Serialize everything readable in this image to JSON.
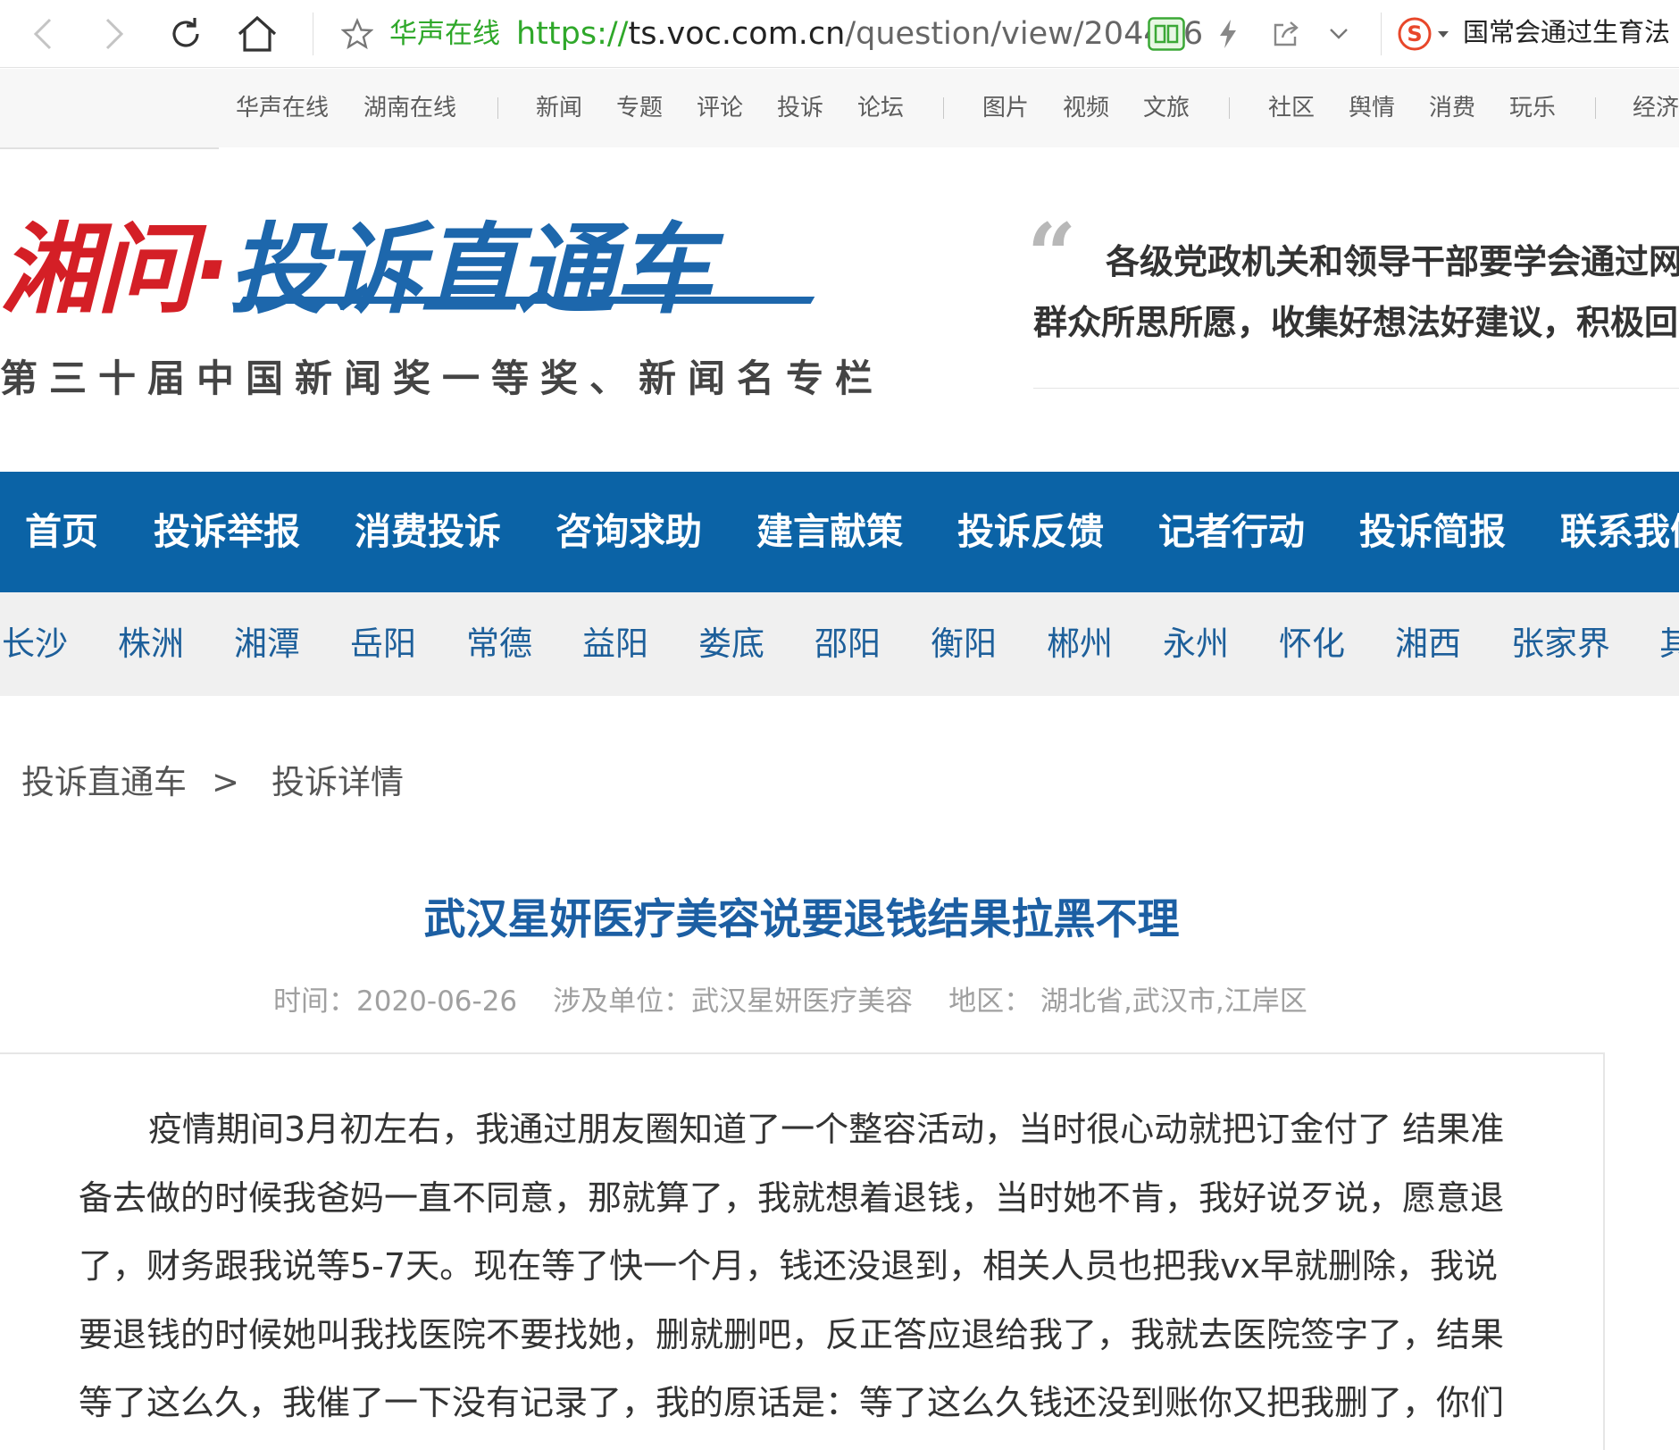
{
  "browser": {
    "site_name": "华声在线",
    "url_scheme": "https://",
    "url_host": "ts.voc.com.cn",
    "url_path": "/question/view/204486",
    "search_text": "国常会通过生育法"
  },
  "top_nav": {
    "items": [
      "华声在线",
      "湖南在线",
      "新闻",
      "专题",
      "评论",
      "投诉",
      "论坛",
      "图片",
      "视频",
      "文旅",
      "社区",
      "舆情",
      "消费",
      "玩乐",
      "经济"
    ]
  },
  "header": {
    "logo_red": "湘问·",
    "logo_blue": "投诉直通车",
    "logo_subtitle": "第三十届中国新闻奖一等奖、新闻名专栏",
    "quote_line1": "各级党政机关和领导干部要学会通过网",
    "quote_line2": "群众所思所愿，收集好想法好建议，积极回"
  },
  "main_nav": {
    "items": [
      "首页",
      "投诉举报",
      "消费投诉",
      "咨询求助",
      "建言献策",
      "投诉反馈",
      "记者行动",
      "投诉简报",
      "联系我们"
    ]
  },
  "region_nav": {
    "items": [
      "长沙",
      "株洲",
      "湘潭",
      "岳阳",
      "常德",
      "益阳",
      "娄底",
      "邵阳",
      "衡阳",
      "郴州",
      "永州",
      "怀化",
      "湘西",
      "张家界",
      "其他"
    ]
  },
  "breadcrumb": {
    "root": "投诉直通车",
    "separator": ">",
    "current": "投诉详情"
  },
  "article": {
    "title": "武汉星妍医疗美容说要退钱结果拉黑不理",
    "meta": {
      "time": "时间：2020-06-26",
      "unit": "涉及单位：武汉星妍医疗美容",
      "region": "地区： 湖北省,武汉市,江岸区"
    },
    "body_lines": [
      "疫情期间3月初左右，我通过朋友圈知道了一个整容活动，当时很心动就把订金付了 结果准",
      "备去做的时候我爸妈一直不同意，那就算了，我就想着退钱，当时她不肯，我好说歹说，愿意退",
      "了，财务跟我说等5-7天。现在等了快一个月，钱还没退到，相关人员也把我vx早就删除，我说",
      "要退钱的时候她叫我找医院不要找她，删就删吧，反正答应退给我了，我就去医院签字了，结果",
      "等了这么久，我催了一下没有记录了，我的原话是：等了这么久钱还没到账你又把我删了，你们"
    ]
  },
  "colors": {
    "brand_blue": "#0b63a6",
    "brand_red": "#d41f26",
    "title_blue": "#1c5fa3",
    "link_green": "#2fa82a"
  },
  "icons": [
    "back-icon",
    "forward-icon",
    "reload-icon",
    "home-icon",
    "star-icon",
    "reader-mode-icon",
    "lightning-icon",
    "share-icon",
    "chevron-down-icon",
    "sogou-search-icon"
  ]
}
